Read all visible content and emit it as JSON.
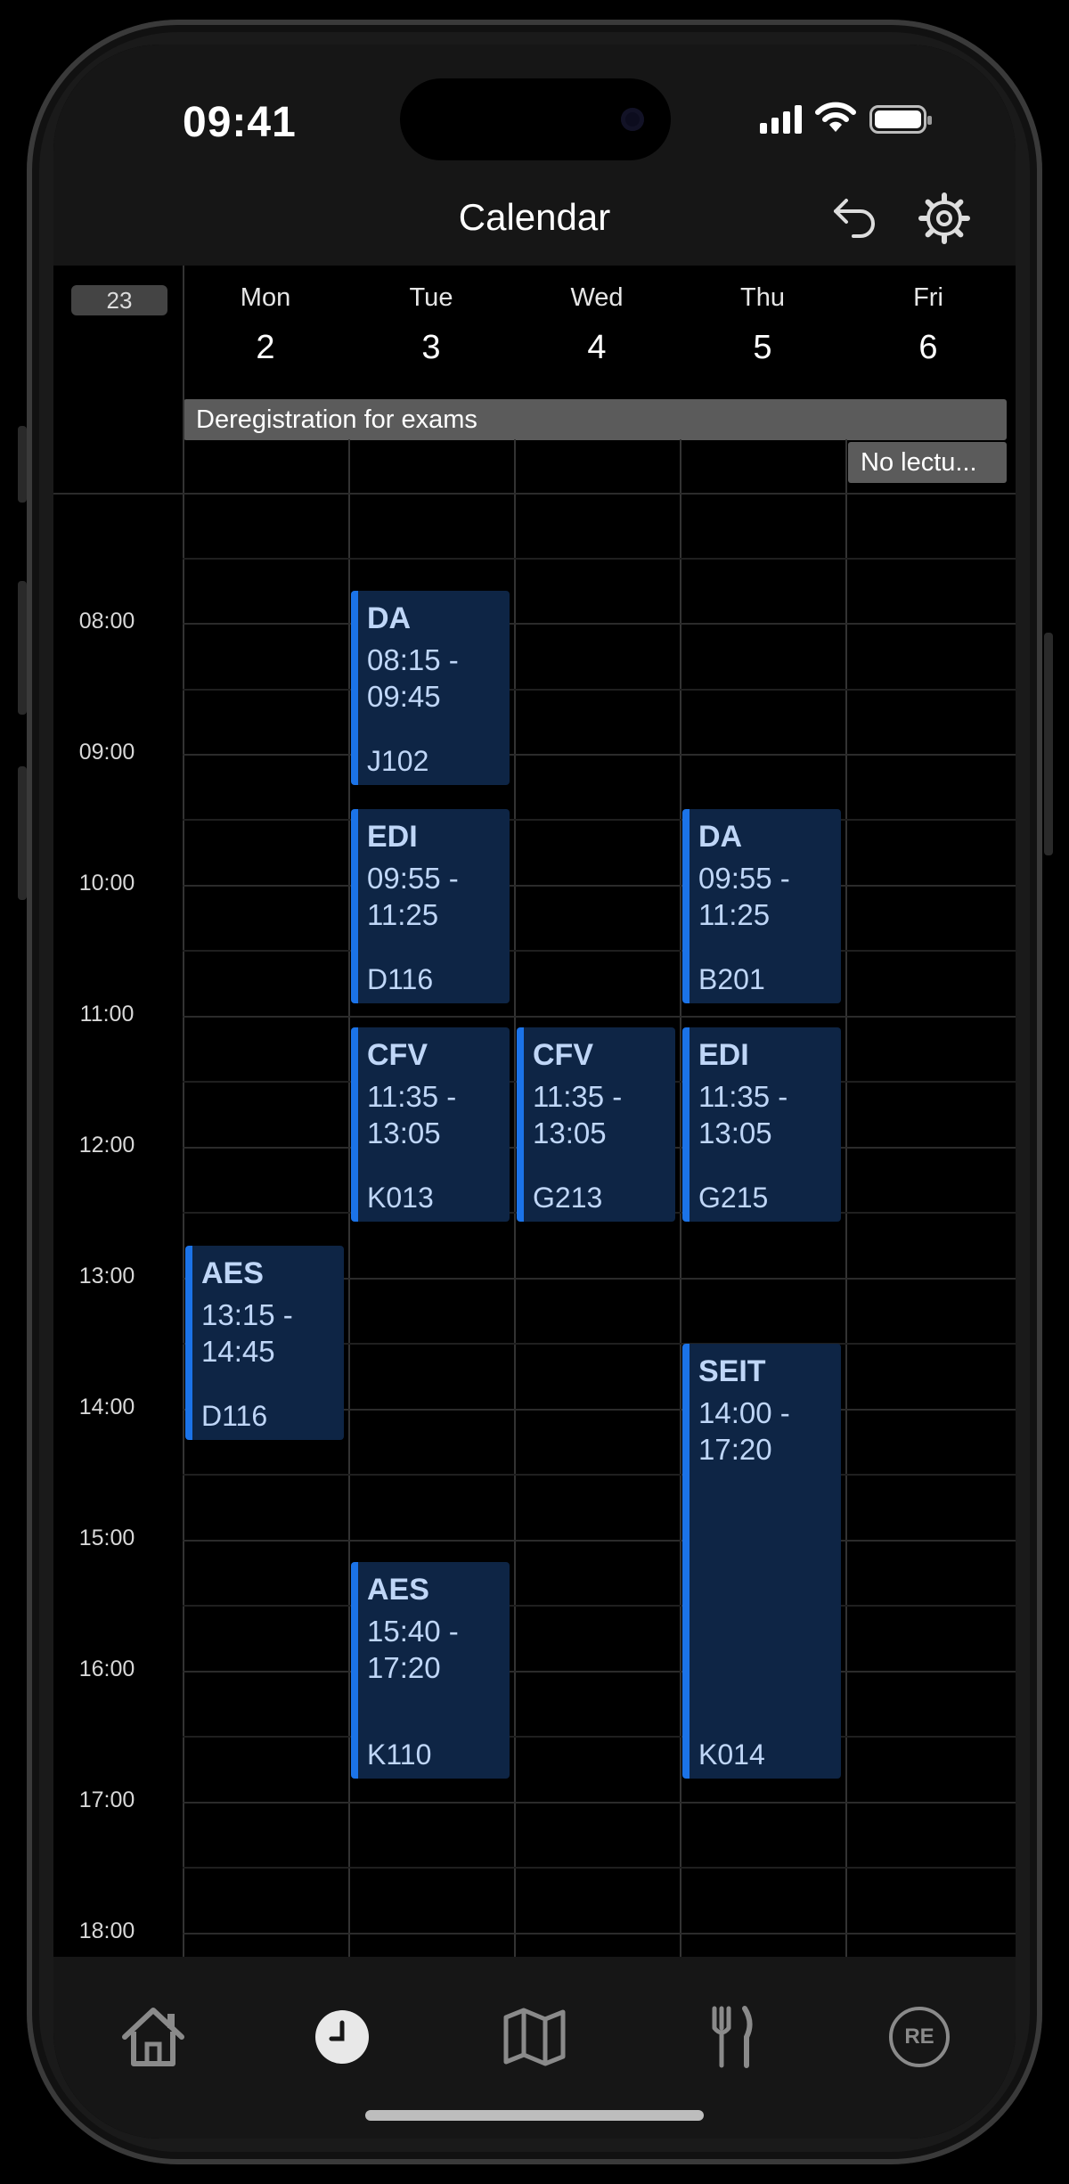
{
  "status_bar": {
    "time": "09:41"
  },
  "header": {
    "title": "Calendar",
    "undo_icon": "undo-icon",
    "settings_icon": "gear-icon"
  },
  "calendar": {
    "week_number": "23",
    "days": [
      {
        "name": "Mon",
        "num": "2"
      },
      {
        "name": "Tue",
        "num": "3"
      },
      {
        "name": "Wed",
        "num": "4"
      },
      {
        "name": "Thu",
        "num": "5"
      },
      {
        "name": "Fri",
        "num": "6"
      }
    ],
    "all_day": [
      {
        "label": "Deregistration for exams"
      },
      {
        "label": "No lectu..."
      }
    ],
    "hours": [
      "08:00",
      "09:00",
      "10:00",
      "11:00",
      "12:00",
      "13:00",
      "14:00",
      "15:00",
      "16:00",
      "17:00",
      "18:00"
    ],
    "events": [
      {
        "title": "DA",
        "time": "08:15 -\n09:45",
        "room": "J102"
      },
      {
        "title": "EDI",
        "time": "09:55 -\n11:25",
        "room": "D116"
      },
      {
        "title": "DA",
        "time": "09:55 -\n11:25",
        "room": "B201"
      },
      {
        "title": "CFV",
        "time": "11:35 -\n13:05",
        "room": "K013"
      },
      {
        "title": "CFV",
        "time": "11:35 -\n13:05",
        "room": "G213"
      },
      {
        "title": "EDI",
        "time": "11:35 -\n13:05",
        "room": "G215"
      },
      {
        "title": "AES",
        "time": "13:15 -\n14:45",
        "room": "D116"
      },
      {
        "title": "SEIT",
        "time": "14:00 -\n17:20",
        "room": "K014"
      },
      {
        "title": "AES",
        "time": "15:40 -\n17:20",
        "room": "K110"
      }
    ]
  },
  "tabbar": {
    "items": [
      "home-icon",
      "clock-icon",
      "map-icon",
      "fork-knife-icon",
      "re-icon"
    ],
    "re_label": "RE"
  },
  "colors": {
    "event_bg": "#0e2545",
    "event_accent": "#1b73e8",
    "event_text": "#bfd6f7",
    "bar_bg": "#161616"
  }
}
